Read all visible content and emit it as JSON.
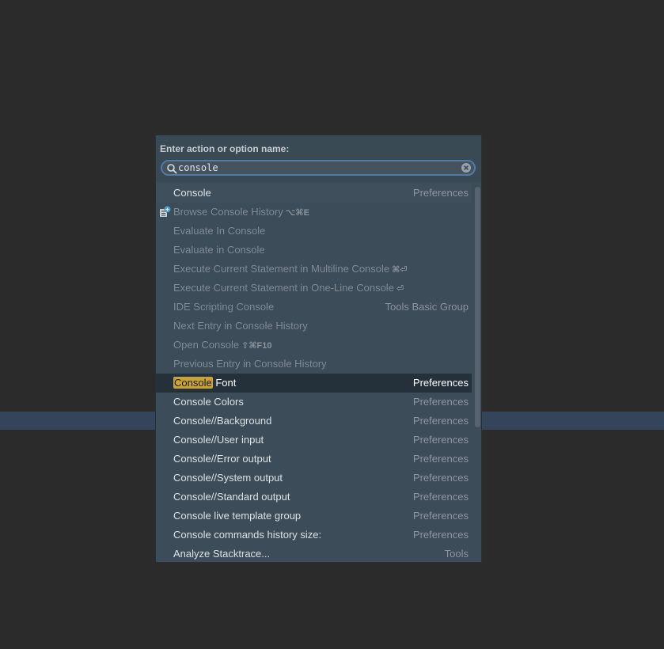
{
  "popup": {
    "prompt": "Enter action or option name:",
    "search": {
      "value": "console"
    }
  },
  "results": [
    {
      "label": "Console",
      "group": "Preferences",
      "state": "enabled"
    },
    {
      "label": "Browse Console History",
      "shortcut": "⌥⌘E",
      "group": "",
      "state": "disabled",
      "icon": "history-icon"
    },
    {
      "label": "Evaluate In Console",
      "group": "",
      "state": "disabled"
    },
    {
      "label": "Evaluate in Console",
      "group": "",
      "state": "disabled"
    },
    {
      "label": "Execute Current Statement in Multiline Console",
      "shortcut": "⌘⏎",
      "group": "",
      "state": "disabled"
    },
    {
      "label": "Execute Current Statement in One-Line Console",
      "shortcut": "⏎",
      "group": "",
      "state": "disabled"
    },
    {
      "label": "IDE Scripting Console",
      "group": "Tools Basic Group",
      "state": "disabled"
    },
    {
      "label": "Next Entry in Console History",
      "group": "",
      "state": "disabled"
    },
    {
      "label": "Open Console",
      "shortcut": "⇧⌘F10",
      "group": "",
      "state": "disabled"
    },
    {
      "label": "Previous Entry in Console History",
      "group": "",
      "state": "disabled"
    },
    {
      "label": "Font",
      "highlight": "Console",
      "group": "Preferences",
      "state": "selected"
    },
    {
      "label": "Console Colors",
      "group": "Preferences",
      "state": "enabled"
    },
    {
      "label": "Console//Background",
      "group": "Preferences",
      "state": "enabled"
    },
    {
      "label": "Console//User input",
      "group": "Preferences",
      "state": "enabled"
    },
    {
      "label": "Console//Error output",
      "group": "Preferences",
      "state": "enabled"
    },
    {
      "label": "Console//System output",
      "group": "Preferences",
      "state": "enabled"
    },
    {
      "label": "Console//Standard output",
      "group": "Preferences",
      "state": "enabled"
    },
    {
      "label": "Console live template group",
      "group": "Preferences",
      "state": "enabled"
    },
    {
      "label": "Console commands history size:",
      "group": "Preferences",
      "state": "enabled"
    },
    {
      "label": "Analyze Stacktrace...",
      "group": "Tools",
      "state": "enabled"
    }
  ],
  "colors": {
    "background": "#2b2b2b",
    "popup": "#3c4c58",
    "selection": "#24303a",
    "match_highlight": "#c9a23a",
    "focus_ring": "#4e7ca6"
  }
}
